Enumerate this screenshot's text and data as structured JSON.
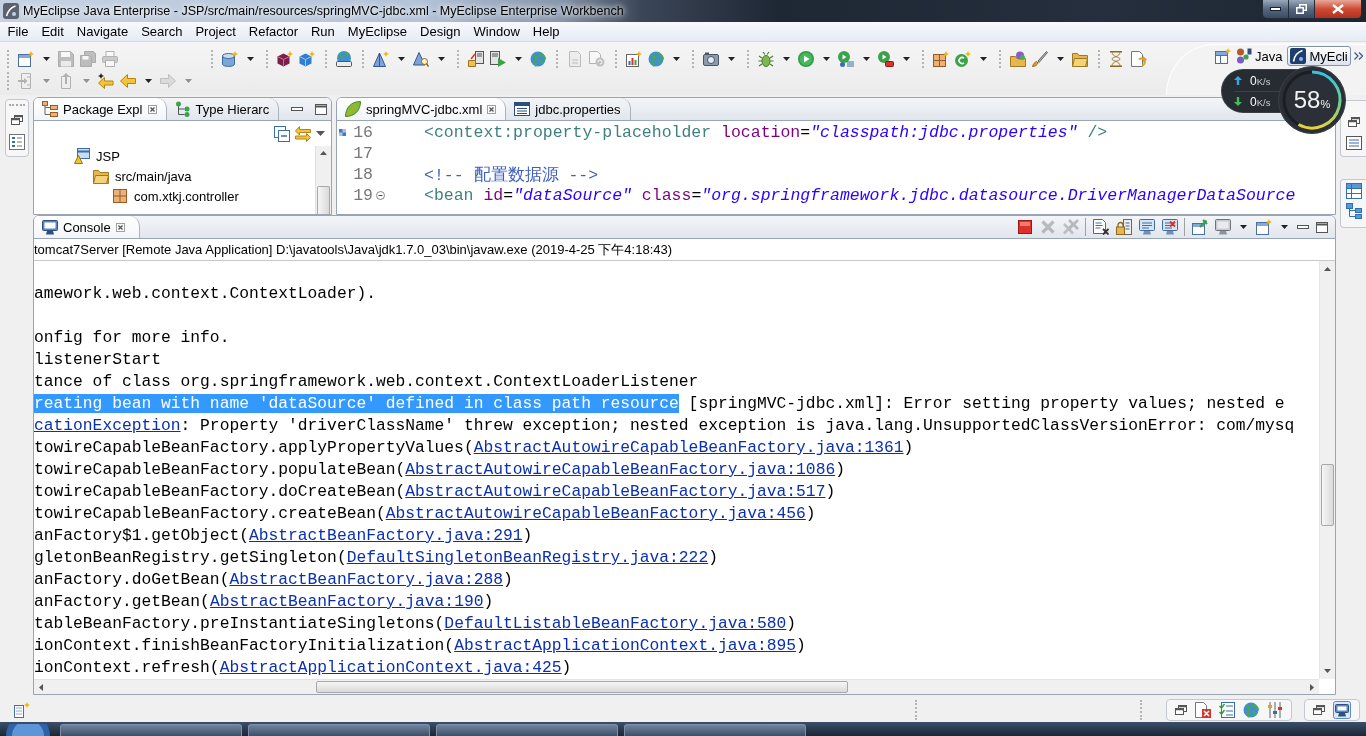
{
  "window": {
    "title": "MyEclipse Java Enterprise - JSP/src/main/resources/springMVC-jdbc.xml - MyEclipse Enterprise Workbench"
  },
  "menu": [
    "File",
    "Edit",
    "Navigate",
    "Search",
    "Project",
    "Refactor",
    "Run",
    "MyEclipse",
    "Design",
    "Window",
    "Help"
  ],
  "toolbar": {
    "rows": [
      [
        {
          "disabled": false
        },
        {
          "disabled": true
        },
        {
          "disabled": true
        },
        {
          "disabled": true
        },
        {
          "disabled": false
        },
        {
          "disabled": false
        },
        {
          "disabled": false
        },
        {
          "disabled": false
        },
        {
          "disabled": false
        },
        {
          "disabled": false
        },
        {
          "disabled": false
        },
        {
          "disabled": false
        },
        {
          "disabled": false
        },
        {
          "disabled": true
        },
        {
          "disabled": true
        },
        {
          "disabled": false
        },
        {
          "disabled": false
        },
        {
          "disabled": false
        },
        {
          "disabled": false
        },
        {
          "disabled": false
        },
        {
          "disabled": false
        },
        {
          "disabled": false
        },
        {
          "disabled": false
        },
        {
          "disabled": false
        },
        {
          "disabled": false
        },
        {
          "disabled": false
        },
        {
          "disabled": false
        },
        {
          "disabled": false
        },
        {
          "disabled": false
        }
      ],
      [
        {
          "disabled": true
        },
        {
          "disabled": true
        },
        {
          "disabled": false
        },
        {
          "disabled": false
        },
        {
          "disabled": true
        }
      ]
    ]
  },
  "perspectives": [
    {
      "label": "Java",
      "selected": false
    },
    {
      "label": "MyEcli",
      "selected": true
    }
  ],
  "network_monitor": {
    "upload": {
      "value": "0",
      "unit": "K/s"
    },
    "download": {
      "value": "0",
      "unit": "K/s"
    },
    "usage": {
      "value": "58",
      "unit": "%",
      "level": 0.58
    }
  },
  "package_explorer": {
    "tabs": [
      {
        "label": "Package Expl",
        "selected": true
      },
      {
        "label": "Type Hierarc",
        "selected": false
      }
    ],
    "tree": [
      {
        "label": "JSP",
        "children": [
          {
            "label": "src/main/java",
            "children": [
              {
                "label": "com.xtkj.controller"
              }
            ]
          }
        ]
      }
    ]
  },
  "editor": {
    "tabs": [
      {
        "label": "springMVC-jdbc.xml",
        "selected": true
      },
      {
        "label": "jdbc.properties",
        "selected": false
      }
    ],
    "lines": [
      {
        "number": "16",
        "annotation": true,
        "fold_marker": false,
        "segments": [
          {
            "kind": "tag",
            "text": "<context:property-placeholder "
          },
          {
            "kind": "attr",
            "text": "location"
          },
          {
            "kind": "plain",
            "text": "="
          },
          {
            "kind": "value",
            "text": "\"classpath:jdbc.properties\""
          },
          {
            "kind": "tag",
            "text": " />"
          }
        ]
      },
      {
        "number": "17",
        "annotation": false,
        "fold_marker": false
      },
      {
        "number": "18",
        "annotation": false,
        "fold_marker": false,
        "segments": [
          {
            "kind": "comment",
            "text": "<!-- 配置数据源 -->"
          }
        ]
      },
      {
        "number": "19",
        "annotation": false,
        "fold_marker": true,
        "segments": [
          {
            "kind": "tag",
            "text": "<bean "
          },
          {
            "kind": "attr",
            "text": "id"
          },
          {
            "kind": "plain",
            "text": "="
          },
          {
            "kind": "value",
            "text": "\"dataSource\""
          },
          {
            "kind": "attr",
            "text": " class"
          },
          {
            "kind": "plain",
            "text": "="
          },
          {
            "kind": "value",
            "text": "\"org.springframework.jdbc.datasource.DriverManagerDataSource"
          }
        ]
      }
    ]
  },
  "console": {
    "tab": "Console",
    "toolbar": [
      {
        "disabled": false
      },
      {
        "disabled": true
      },
      {
        "disabled": true
      },
      {
        "disabled": false
      },
      {
        "disabled": false
      },
      {
        "disabled": false
      },
      {
        "disabled": false
      },
      {
        "disabled": false
      },
      {
        "disabled": false
      },
      {
        "disabled": false
      }
    ],
    "process": "tomcat7Server [Remote Java Application] D:\\javatools\\Java\\jdk1.7.0_03\\bin\\javaw.exe (2019-4-25 下午4:18:43)",
    "lines": [
      {
        "kind": "blank"
      },
      {
        "kind": "text",
        "segments": [
          {
            "kind": "text",
            "text": "amework.web.context.ContextLoader)."
          }
        ]
      },
      {
        "kind": "blank"
      },
      {
        "kind": "text",
        "segments": [
          {
            "kind": "text",
            "text": "onfig for more info."
          }
        ]
      },
      {
        "kind": "text",
        "segments": [
          {
            "kind": "text",
            "text": "listenerStart"
          }
        ]
      },
      {
        "kind": "text",
        "segments": [
          {
            "kind": "text",
            "text": "tance of class org.springframework.web.context.ContextLoaderListener"
          }
        ]
      },
      {
        "kind": "text",
        "segments": [
          {
            "kind": "selected",
            "text": "reating bean with name 'dataSource' defined in class path resource"
          },
          {
            "kind": "text",
            "text": " [springMVC-jdbc.xml]: Error setting property values; nested e"
          }
        ]
      },
      {
        "kind": "text",
        "segments": [
          {
            "kind": "link",
            "text": "cationException"
          },
          {
            "kind": "text",
            "text": ": Property 'driverClassName' threw exception; nested exception is java.lang.UnsupportedClassVersionError: com/mysq"
          }
        ]
      },
      {
        "kind": "text",
        "segments": [
          {
            "kind": "text",
            "text": "towireCapableBeanFactory.applyPropertyValues("
          },
          {
            "kind": "link",
            "text": "AbstractAutowireCapableBeanFactory.java:1361"
          },
          {
            "kind": "text",
            "text": ")"
          }
        ]
      },
      {
        "kind": "text",
        "segments": [
          {
            "kind": "text",
            "text": "towireCapableBeanFactory.populateBean("
          },
          {
            "kind": "link",
            "text": "AbstractAutowireCapableBeanFactory.java:1086"
          },
          {
            "kind": "text",
            "text": ")"
          }
        ]
      },
      {
        "kind": "text",
        "segments": [
          {
            "kind": "text",
            "text": "towireCapableBeanFactory.doCreateBean("
          },
          {
            "kind": "link",
            "text": "AbstractAutowireCapableBeanFactory.java:517"
          },
          {
            "kind": "text",
            "text": ")"
          }
        ]
      },
      {
        "kind": "text",
        "segments": [
          {
            "kind": "text",
            "text": "towireCapableBeanFactory.createBean("
          },
          {
            "kind": "link",
            "text": "AbstractAutowireCapableBeanFactory.java:456"
          },
          {
            "kind": "text",
            "text": ")"
          }
        ]
      },
      {
        "kind": "text",
        "segments": [
          {
            "kind": "text",
            "text": "anFactory$1.getObject("
          },
          {
            "kind": "link",
            "text": "AbstractBeanFactory.java:291"
          },
          {
            "kind": "text",
            "text": ")"
          }
        ]
      },
      {
        "kind": "text",
        "segments": [
          {
            "kind": "text",
            "text": "gletonBeanRegistry.getSingleton("
          },
          {
            "kind": "link",
            "text": "DefaultSingletonBeanRegistry.java:222"
          },
          {
            "kind": "text",
            "text": ")"
          }
        ]
      },
      {
        "kind": "text",
        "segments": [
          {
            "kind": "text",
            "text": "anFactory.doGetBean("
          },
          {
            "kind": "link",
            "text": "AbstractBeanFactory.java:288"
          },
          {
            "kind": "text",
            "text": ")"
          }
        ]
      },
      {
        "kind": "text",
        "segments": [
          {
            "kind": "text",
            "text": "anFactory.getBean("
          },
          {
            "kind": "link",
            "text": "AbstractBeanFactory.java:190"
          },
          {
            "kind": "text",
            "text": ")"
          }
        ]
      },
      {
        "kind": "text",
        "segments": [
          {
            "kind": "text",
            "text": "tableBeanFactory.preInstantiateSingletons("
          },
          {
            "kind": "link",
            "text": "DefaultListableBeanFactory.java:580"
          },
          {
            "kind": "text",
            "text": ")"
          }
        ]
      },
      {
        "kind": "text",
        "segments": [
          {
            "kind": "text",
            "text": "ionContext.finishBeanFactoryInitialization("
          },
          {
            "kind": "link",
            "text": "AbstractApplicationContext.java:895"
          },
          {
            "kind": "text",
            "text": ")"
          }
        ]
      },
      {
        "kind": "text",
        "segments": [
          {
            "kind": "text",
            "text": "ionContext.refresh("
          },
          {
            "kind": "link",
            "text": "AbstractApplicationContext.java:425"
          },
          {
            "kind": "text",
            "text": ")"
          }
        ]
      }
    ]
  }
}
